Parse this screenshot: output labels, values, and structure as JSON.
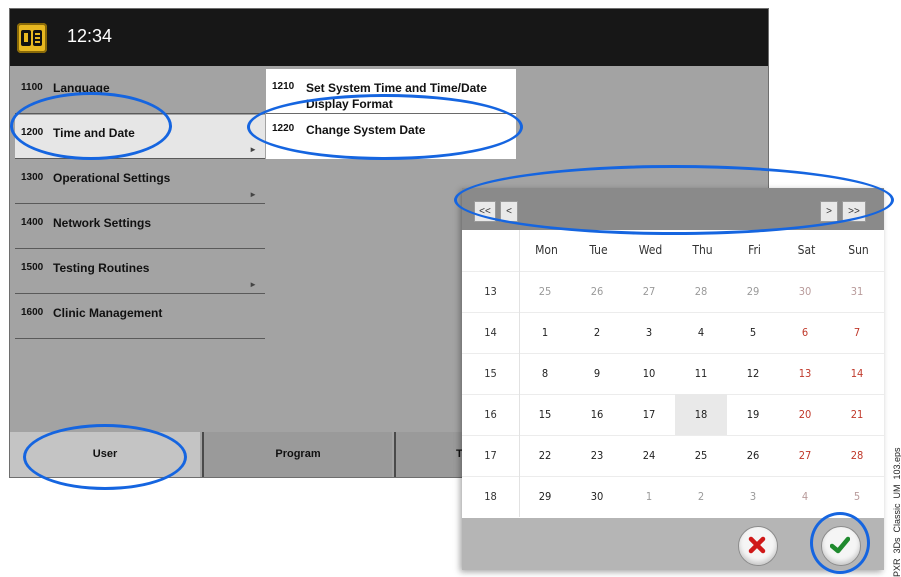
{
  "header": {
    "time": "12:34",
    "logo_icon": "device-logo-icon"
  },
  "menu": {
    "items": [
      {
        "num": "1100",
        "label": "Language",
        "arrow": ""
      },
      {
        "num": "1200",
        "label": "Time and Date",
        "arrow": "►",
        "selected": true
      },
      {
        "num": "1300",
        "label": "Operational Settings",
        "arrow": "►"
      },
      {
        "num": "1400",
        "label": "Network Settings",
        "arrow": ""
      },
      {
        "num": "1500",
        "label": "Testing Routines",
        "arrow": "►"
      },
      {
        "num": "1600",
        "label": "Clinic Management",
        "arrow": ""
      }
    ]
  },
  "submenu": {
    "items": [
      {
        "num": "1210",
        "label": "Set System Time and Time/Date Display Format"
      },
      {
        "num": "1220",
        "label": "Change System Date"
      }
    ]
  },
  "tabs": {
    "user": "User",
    "program": "Program",
    "third": "T"
  },
  "calendar": {
    "nav": {
      "first": "<<",
      "prev": "<",
      "next": ">",
      "last": ">>"
    },
    "day_headers": [
      "Mon",
      "Tue",
      "Wed",
      "Thu",
      "Fri",
      "Sat",
      "Sun"
    ],
    "weeks": [
      {
        "week": "13",
        "days": [
          "25",
          "26",
          "27",
          "28",
          "29",
          "30",
          "31"
        ]
      },
      {
        "week": "14",
        "days": [
          "1",
          "2",
          "3",
          "4",
          "5",
          "6",
          "7"
        ]
      },
      {
        "week": "15",
        "days": [
          "8",
          "9",
          "10",
          "11",
          "12",
          "13",
          "14"
        ]
      },
      {
        "week": "16",
        "days": [
          "15",
          "16",
          "17",
          "18",
          "19",
          "20",
          "21"
        ]
      },
      {
        "week": "17",
        "days": [
          "22",
          "23",
          "24",
          "25",
          "26",
          "27",
          "28"
        ]
      },
      {
        "week": "18",
        "days": [
          "29",
          "30",
          "1",
          "2",
          "3",
          "4",
          "5"
        ]
      }
    ],
    "today": "18",
    "cancel_icon": "cancel-x-icon",
    "confirm_icon": "confirm-check-icon"
  },
  "colors": {
    "annotation": "#1565e0",
    "weekend": "#c0392b",
    "logo": "#e8b820"
  },
  "caption": "PXR_3Ds_Classic_UM_103.eps"
}
